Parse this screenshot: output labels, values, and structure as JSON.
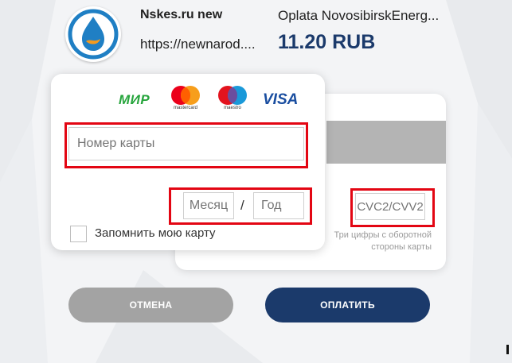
{
  "merchant": {
    "name": "Nskes.ru new",
    "url": "https://newnarod...."
  },
  "order": {
    "description": "Oplata NovosibirskEnerg...",
    "amount": "11.20 RUB"
  },
  "payment_systems": {
    "mir": "МИР",
    "mastercard": "mastercard",
    "maestro": "maestro",
    "visa": "VISA"
  },
  "form": {
    "card_number_placeholder": "Номер карты",
    "month_placeholder": "Месяц",
    "year_placeholder": "Год",
    "separator": "/",
    "cvc_placeholder": "CVC2/CVV2",
    "cvc_hint": "Три цифры с оборотной стороны карты",
    "remember_label": "Запомнить мою карту"
  },
  "buttons": {
    "cancel": "ОТМЕНА",
    "pay": "ОПЛАТИТЬ"
  },
  "colors": {
    "highlight": "#e30613",
    "primary": "#1b3a6b",
    "cancel": "#a3a3a3"
  }
}
